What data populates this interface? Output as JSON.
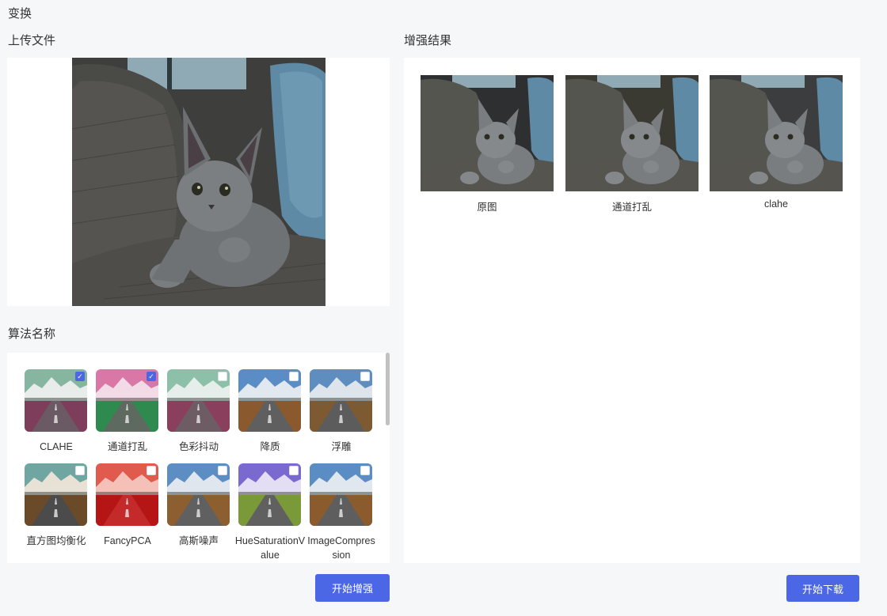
{
  "page": {
    "title": "变换"
  },
  "upload": {
    "title": "上传文件"
  },
  "algorithms": {
    "title": "算法名称",
    "items": [
      {
        "label": "CLAHE",
        "checked": true,
        "sky": "#86b6a0",
        "mountain": "#e8ecea",
        "ground": "#7e3d5a",
        "road": "#6b5a63"
      },
      {
        "label": "通道打乱",
        "checked": true,
        "sky": "#d978a6",
        "mountain": "#f2dbe6",
        "ground": "#2f8a4f",
        "road": "#5e6a5f"
      },
      {
        "label": "色彩抖动",
        "checked": false,
        "sky": "#8cc0a8",
        "mountain": "#e5eeea",
        "ground": "#8a3f5c",
        "road": "#6e5c65"
      },
      {
        "label": "降质",
        "checked": false,
        "sky": "#5a8dc5",
        "mountain": "#e2e8f0",
        "ground": "#8a5a2e",
        "road": "#5f5f60"
      },
      {
        "label": "浮雕",
        "checked": false,
        "sky": "#5e8dc0",
        "mountain": "#dde4ec",
        "ground": "#7e5a33",
        "road": "#5c5c5c"
      },
      {
        "label": "直方图均衡化",
        "checked": false,
        "sky": "#6fa6a1",
        "mountain": "#e8e2d6",
        "ground": "#6b4a2a",
        "road": "#4b4b4b"
      },
      {
        "label": "FancyPCA",
        "checked": false,
        "sky": "#e05a4e",
        "mountain": "#f4c0b8",
        "ground": "#b51515",
        "road": "#c42a2a"
      },
      {
        "label": "高斯噪声",
        "checked": false,
        "sky": "#5c8ec4",
        "mountain": "#dfe6ee",
        "ground": "#8c5e30",
        "road": "#606060"
      },
      {
        "label": "HueSaturationValue",
        "checked": false,
        "sky": "#7a6ad0",
        "mountain": "#e4def4",
        "ground": "#7a9a3a",
        "road": "#606060"
      },
      {
        "label": "ImageCompression",
        "checked": false,
        "sky": "#5a8dc4",
        "mountain": "#e0e7ef",
        "ground": "#8b5b2d",
        "road": "#5e5e5e"
      }
    ]
  },
  "results": {
    "title": "增强结果",
    "items": [
      {
        "label": "原图",
        "tint": "#2d2f30"
      },
      {
        "label": "通道打乱",
        "tint": "#3a3a32"
      },
      {
        "label": "clahe",
        "tint": "#3b3d3e"
      }
    ]
  },
  "buttons": {
    "enhance": "开始增强",
    "download": "开始下载"
  }
}
